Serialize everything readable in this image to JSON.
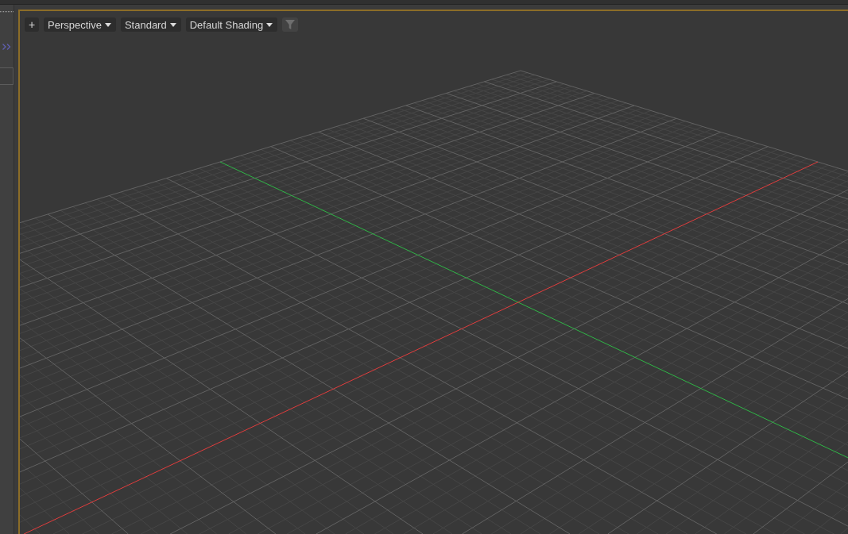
{
  "viewport": {
    "active": true,
    "toolbar": [
      {
        "kind": "button",
        "label": "+"
      },
      {
        "kind": "dropdown",
        "label": "Perspective"
      },
      {
        "kind": "dropdown",
        "label": "Standard"
      },
      {
        "kind": "dropdown",
        "label": "Default Shading"
      },
      {
        "kind": "filter"
      }
    ]
  }
}
